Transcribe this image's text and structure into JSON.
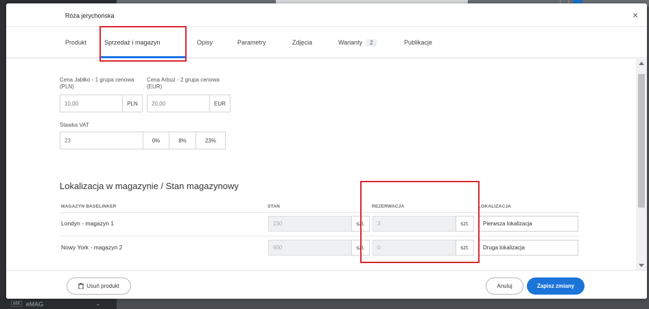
{
  "backdrop": {
    "bottom_tag": "eM",
    "bottom_label": "eMAG"
  },
  "modal": {
    "title": "Róża jerychońska",
    "close_label": "×"
  },
  "tabs": [
    {
      "label": "Produkt"
    },
    {
      "label": "Sprzedaż i magazyn",
      "active": true
    },
    {
      "label": "Opisy"
    },
    {
      "label": "Parametry"
    },
    {
      "label": "Zdjęcia"
    },
    {
      "label": "Warianty",
      "badge": "2"
    },
    {
      "label": "Publikacje"
    }
  ],
  "prices": {
    "price1_label": "Cena Jabłko - 1 grupa cenowa (PLN)",
    "price1_value": "10,00",
    "price1_currency": "PLN",
    "price2_label": "Cena Arbuz - 2 grupa cenowa (EUR)",
    "price2_value": "20,00",
    "price2_currency": "EUR"
  },
  "vat": {
    "label": "Stawka VAT",
    "value": "23",
    "options": [
      "0%",
      "8%",
      "23%"
    ]
  },
  "stock": {
    "title": "Lokalizacja w magazynie / Stan magazynowy",
    "headers": {
      "warehouse": "MAGAZYN BASELINKER",
      "stock": "STAN",
      "reservation": "REZERWACJA",
      "location": "LOKALIZACJA"
    },
    "rows": [
      {
        "warehouse": "Londyn - magazyn 1",
        "stock": "230",
        "stock_unit": "szt.",
        "reservation": "3",
        "reservation_unit": "szt.",
        "location": "Pierwsza lokalizacja"
      },
      {
        "warehouse": "Nowy York - magazyn 2",
        "stock": "600",
        "stock_unit": "szt.",
        "reservation": "0",
        "reservation_unit": "szt.",
        "location": "Druga lokalizacja"
      }
    ]
  },
  "footer": {
    "delete_label": "Usuń produkt",
    "cancel_label": "Anuluj",
    "save_label": "Zapisz zmiany"
  },
  "colors": {
    "accent": "#1c74d9",
    "highlight_box": "#d9232e"
  }
}
